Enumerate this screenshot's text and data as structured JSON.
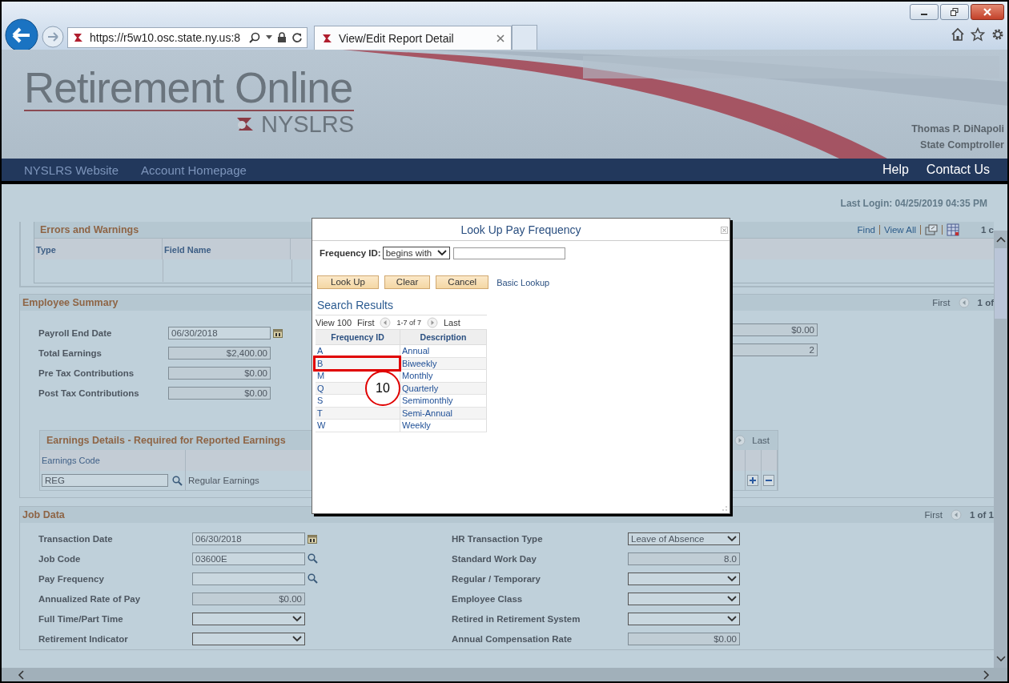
{
  "browser": {
    "url": "https://r5w10.osc.state.ny.us:8",
    "tab_title": "View/Edit Report Detail"
  },
  "header": {
    "logo_title": "Retirement Online",
    "logo_subtitle": "NYSLRS",
    "official_name": "Thomas P. DiNapoli",
    "official_title": "State Comptroller"
  },
  "nav": {
    "left_links": [
      "NYSLRS Website",
      "Account Homepage"
    ],
    "right_links": [
      "Help",
      "Contact Us"
    ]
  },
  "last_login": "Last Login: 04/25/2019 04:35 PM",
  "errors_section": {
    "title": "Errors and Warnings",
    "toolbar": [
      "Find",
      "View All"
    ],
    "counter": "1 c",
    "columns": [
      "Type",
      "Field Name"
    ]
  },
  "employee_summary": {
    "title": "Employee Summary",
    "nav_first": "First",
    "counter": "1 of",
    "fields": [
      {
        "label": "Payroll End Date",
        "kind": "date",
        "value": "06/30/2018"
      },
      {
        "label": "Total Earnings",
        "kind": "readonly",
        "value": "$2,400.00"
      },
      {
        "label": "Pre Tax Contributions",
        "kind": "readonly",
        "value": "$0.00"
      },
      {
        "label": "Post Tax Contributions",
        "kind": "readonly",
        "value": "$0.00"
      }
    ],
    "right_values": [
      "$0.00",
      "2"
    ],
    "earnings": {
      "title": "Earnings Details - Required for Reported Earnings",
      "nav_last": "Last",
      "column": "Earnings Code",
      "code": "REG",
      "description": "Regular Earnings"
    }
  },
  "job_data": {
    "title": "Job Data",
    "nav_first": "First",
    "counter": "1 of 1",
    "left_fields": [
      {
        "label": "Transaction Date",
        "kind": "date",
        "value": "06/30/2018"
      },
      {
        "label": "Job Code",
        "kind": "lookup",
        "value": "03600E"
      },
      {
        "label": "Pay Frequency",
        "kind": "lookup"
      },
      {
        "label": "Annualized Rate of Pay",
        "kind": "readonly",
        "value": "$0.00"
      },
      {
        "label": "Full Time/Part Time",
        "kind": "dropdown"
      },
      {
        "label": "Retirement Indicator",
        "kind": "dropdown"
      }
    ],
    "right_fields": [
      {
        "label": "HR Transaction Type",
        "kind": "dropdown",
        "value": "Leave of Absence"
      },
      {
        "label": "Standard Work Day",
        "kind": "readonly",
        "value": "8.0"
      },
      {
        "label": "Regular / Temporary",
        "kind": "dropdown"
      },
      {
        "label": "Employee Class",
        "kind": "dropdown"
      },
      {
        "label": "Retired in Retirement System",
        "kind": "dropdown"
      },
      {
        "label": "Annual Compensation Rate",
        "kind": "readonly",
        "value": "$0.00"
      }
    ]
  },
  "lookup_dialog": {
    "title": "Look Up Pay Frequency",
    "field_label": "Frequency ID:",
    "operator": "begins with",
    "buttons": [
      "Look Up",
      "Clear",
      "Cancel"
    ],
    "link": "Basic Lookup",
    "results_title": "Search Results",
    "view_link": "View 100",
    "first": "First",
    "range": "1-7 of 7",
    "last": "Last",
    "columns": [
      "Frequency ID",
      "Description"
    ],
    "rows": [
      {
        "id": "A",
        "description": "Annual",
        "highlighted": false
      },
      {
        "id": "B",
        "description": "Biweekly",
        "highlighted": true
      },
      {
        "id": "M",
        "description": "Monthly",
        "highlighted": false
      },
      {
        "id": "Q",
        "description": "Quarterly",
        "highlighted": false
      },
      {
        "id": "S",
        "description": "Semimonthly",
        "highlighted": false
      },
      {
        "id": "T",
        "description": "Semi-Annual",
        "highlighted": false
      },
      {
        "id": "W",
        "description": "Weekly",
        "highlighted": false
      }
    ]
  },
  "callout": {
    "number": "10"
  }
}
